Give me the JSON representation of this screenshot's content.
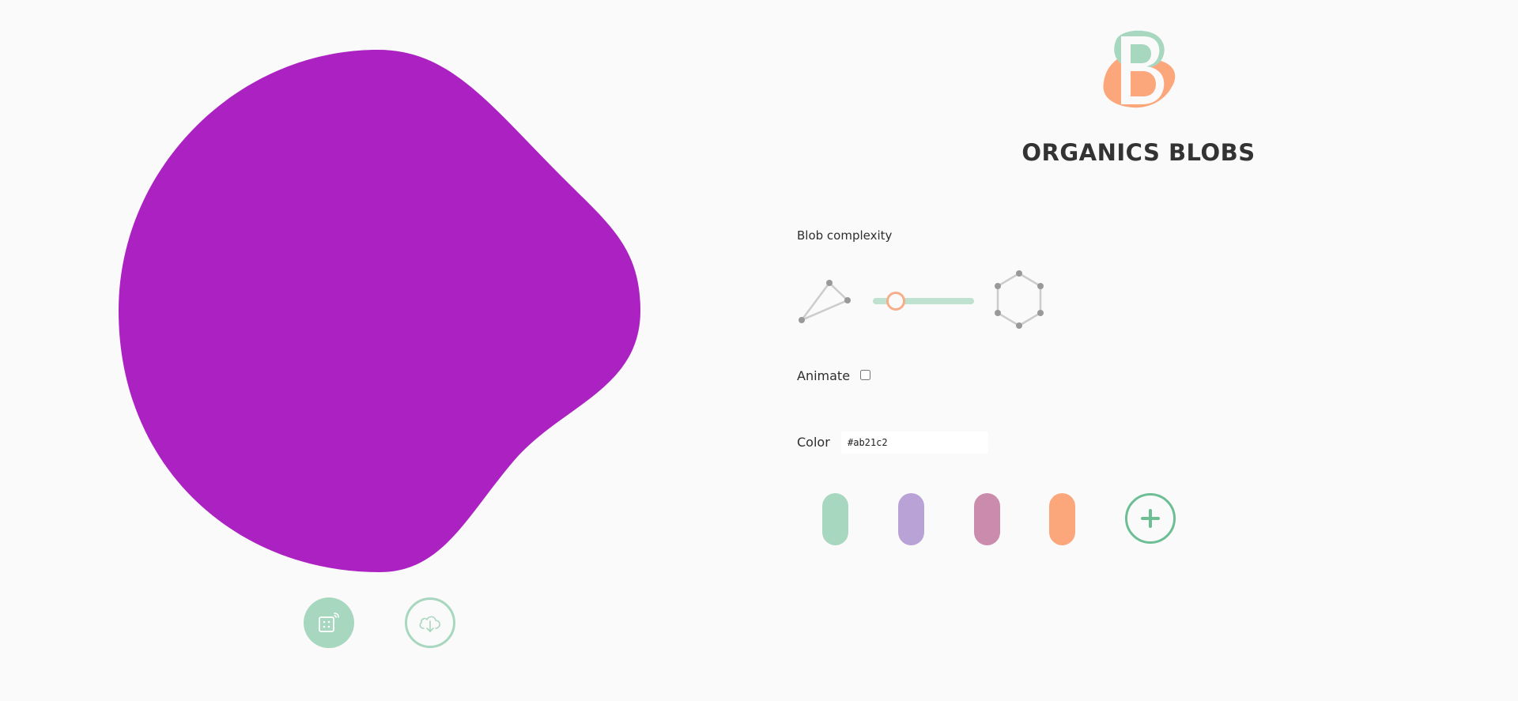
{
  "app": {
    "title": "ORGANICS BLOBS",
    "logo_icon": "organic-blobs-logo"
  },
  "blob": {
    "fill": "#ab21c2"
  },
  "actions": {
    "randomize_icon": "dice-icon",
    "download_icon": "cloud-download-icon"
  },
  "controls": {
    "complexity": {
      "label": "Blob complexity",
      "min_icon": "triangle-nodes-icon",
      "max_icon": "hexagon-nodes-icon",
      "value_fraction": 0.23
    },
    "animate": {
      "label": "Animate",
      "checked": false
    },
    "color": {
      "label": "Color",
      "value": "#ab21c2"
    },
    "swatches": [
      {
        "color": "#a7d7bf"
      },
      {
        "color": "#b9a2d6"
      },
      {
        "color": "#cb8bad"
      },
      {
        "color": "#fca67c"
      }
    ],
    "add_color_icon": "plus-icon"
  },
  "colors": {
    "accent": "#a7d7bf",
    "accent_dark": "#6dbd95",
    "slider_thumb": "#f6ae8a",
    "text": "#333333",
    "background": "#fafafa"
  }
}
